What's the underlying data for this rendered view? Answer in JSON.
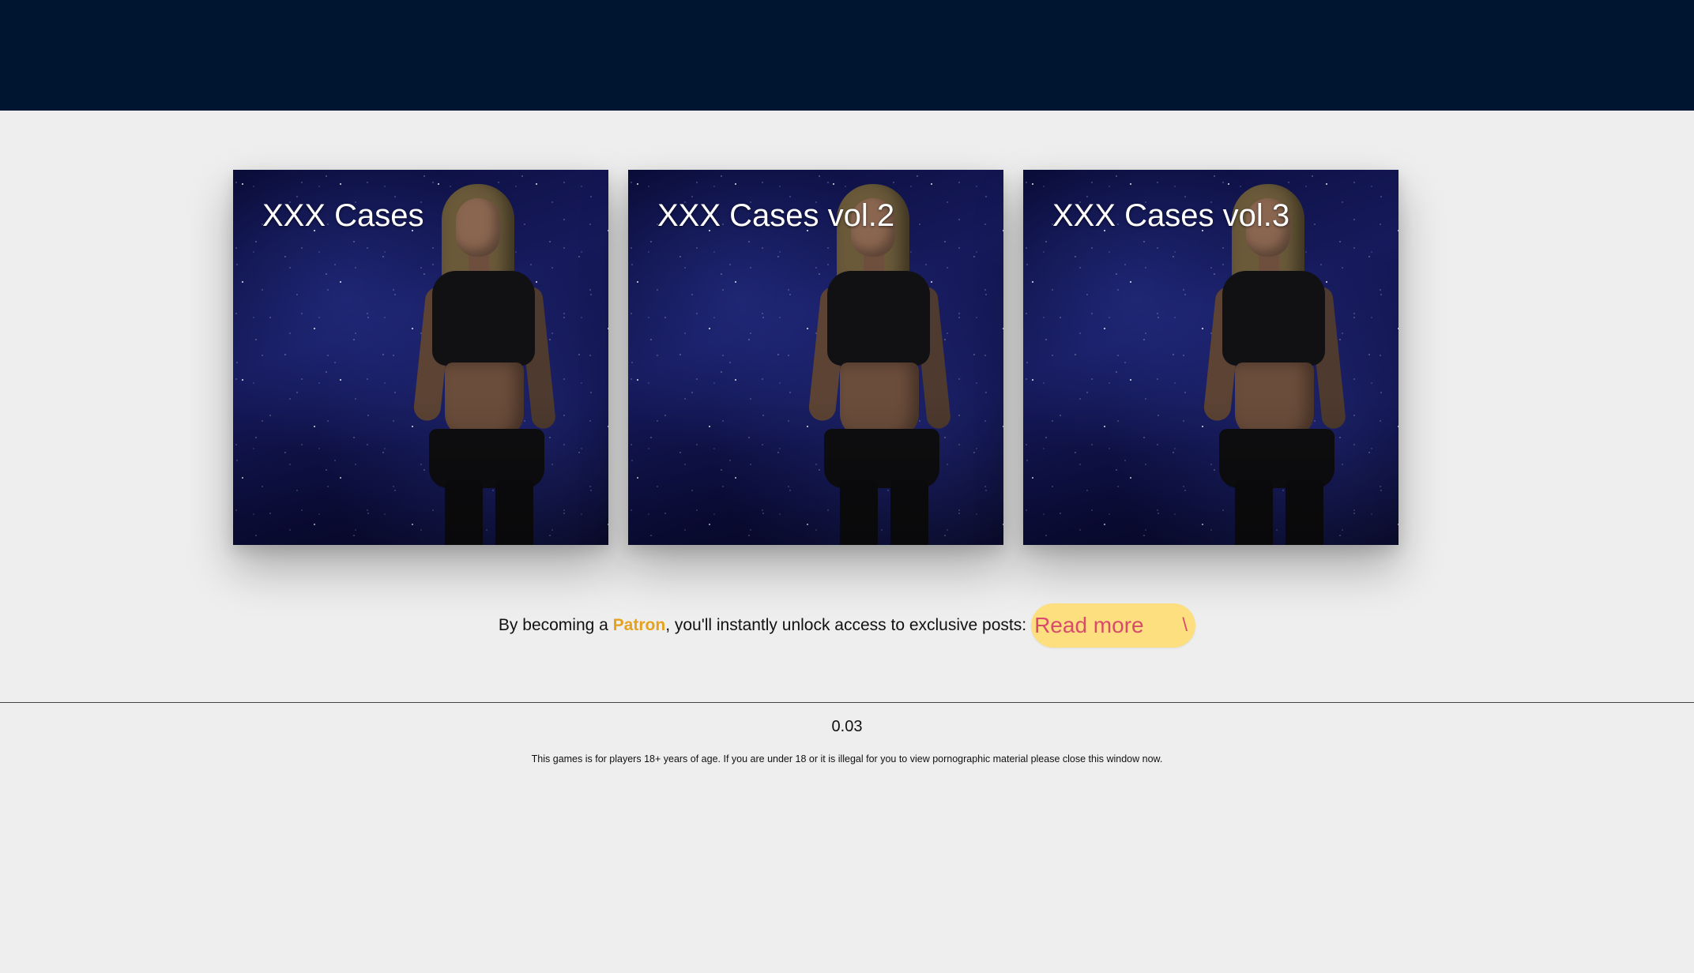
{
  "header": {
    "background_color": "#001530"
  },
  "cards": [
    {
      "title": "XXX Cases"
    },
    {
      "title": "XXX Cases vol.2"
    },
    {
      "title": "XXX Cases vol.3"
    }
  ],
  "promo": {
    "text_before": "By becoming a ",
    "patron_label": "Patron",
    "text_after": ", you'll instantly unlock access to exclusive posts:",
    "read_more_label": "Read more",
    "read_more_arrow": "\\",
    "patron_color": "#e6a21c",
    "button_color": "#fddf80",
    "button_text_color": "#d94b6a"
  },
  "footer": {
    "version": "0.03",
    "disclaimer": "This games is for players 18+ years of age. If you are under 18 or it is illegal for you to view pornographic material please close this window now."
  }
}
